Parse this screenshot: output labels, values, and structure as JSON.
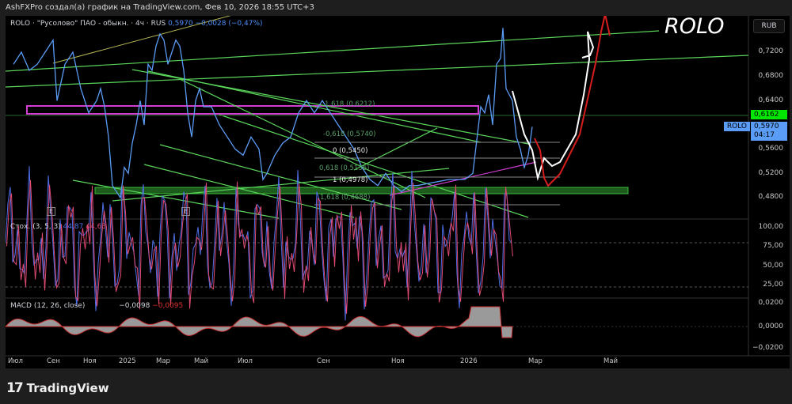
{
  "header": {
    "attribution": "AshFXPro создал(а) график на TradingView.com, Фев 10, 2026 18:55 UTC+3"
  },
  "legend": {
    "title": "ROLO · \"Русолово\" ПАО - обыкн. · 4ч · RUS",
    "price": "0,5970",
    "change": "−0,0028 (−0,47%)"
  },
  "annotation": "ROLO",
  "currency": "RUB",
  "price_axis": [
    "0,7200",
    "0,6800",
    "0,6400",
    "0,5600",
    "0,5200",
    "0,4800"
  ],
  "tags": {
    "level": "0,6162",
    "symbol": "ROLO",
    "last": "0,5970",
    "countdown": "04:17",
    "level_color": "#00e600",
    "last_color": "#5b9cf6"
  },
  "fib_labels": [
    "1,618 (0,6212)",
    "-0,618 (0,5740)",
    "0 (0,5450)",
    "0,618 (0,5136)",
    "1 (0,4978)",
    "1,618 (0,4688)"
  ],
  "events": [
    "E",
    "E"
  ],
  "stoch": {
    "label": "Стох. (3, 5, 3)",
    "k": "44,87",
    "d": "44,63",
    "axis": [
      "100,00",
      "75,00",
      "50,00",
      "25,00"
    ]
  },
  "macd": {
    "label": "MACD (12, 26, close)",
    "macd": "−0,0098",
    "signal": "−0,0095",
    "axis": [
      "0,0200",
      "0,0000",
      "−0,0200"
    ]
  },
  "time_axis": [
    "Июл",
    "Сен",
    "Ноя",
    "2025",
    "Мар",
    "Май",
    "Июл",
    "Сен",
    "Ноя",
    "2026",
    "Мар",
    "Май"
  ],
  "footer": {
    "brand": "TradingView"
  },
  "chart_data": {
    "type": "line",
    "ylim": [
      0.46,
      0.78
    ],
    "x": [
      10,
      20,
      30,
      40,
      50,
      60,
      65,
      75,
      85,
      95,
      105,
      115,
      120,
      125,
      130,
      135,
      140,
      145,
      150,
      155,
      160,
      165,
      170,
      175,
      180,
      185,
      190,
      195,
      200,
      205,
      210,
      215,
      220,
      225,
      230,
      235,
      240,
      245,
      250,
      260,
      270,
      280,
      290,
      300,
      310,
      320,
      325,
      330,
      340,
      350,
      360,
      370,
      380,
      390,
      400,
      410,
      420,
      430,
      440,
      450,
      460,
      470,
      480,
      490,
      500,
      510,
      520,
      540,
      560,
      580,
      590,
      600,
      605,
      610,
      615,
      620,
      625,
      628,
      632,
      640,
      645,
      650,
      655,
      660,
      665
    ],
    "values": [
      0.7,
      0.72,
      0.69,
      0.7,
      0.72,
      0.74,
      0.64,
      0.7,
      0.72,
      0.66,
      0.62,
      0.64,
      0.66,
      0.63,
      0.58,
      0.5,
      0.49,
      0.48,
      0.53,
      0.52,
      0.57,
      0.6,
      0.64,
      0.6,
      0.7,
      0.69,
      0.73,
      0.75,
      0.74,
      0.7,
      0.72,
      0.74,
      0.73,
      0.69,
      0.62,
      0.58,
      0.64,
      0.66,
      0.63,
      0.63,
      0.6,
      0.58,
      0.56,
      0.55,
      0.58,
      0.56,
      0.51,
      0.52,
      0.55,
      0.57,
      0.58,
      0.62,
      0.64,
      0.62,
      0.64,
      0.62,
      0.6,
      0.58,
      0.56,
      0.53,
      0.51,
      0.5,
      0.52,
      0.5,
      0.49,
      0.5,
      0.5,
      0.505,
      0.51,
      0.51,
      0.52,
      0.63,
      0.62,
      0.65,
      0.6,
      0.7,
      0.71,
      0.76,
      0.66,
      0.64,
      0.58,
      0.56,
      0.53,
      0.55,
      0.597
    ]
  }
}
